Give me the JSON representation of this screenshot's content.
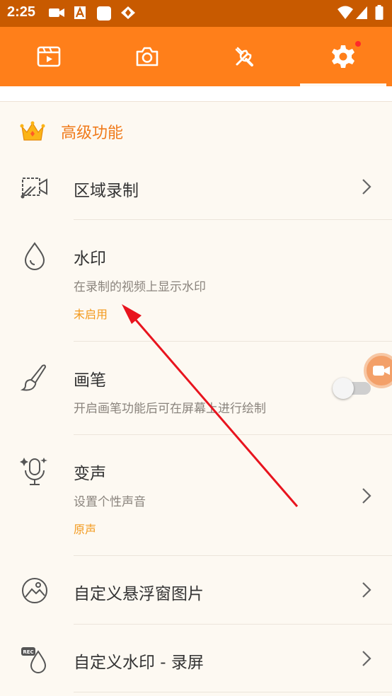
{
  "status_bar": {
    "time": "2:25"
  },
  "tabs": [
    {
      "name": "video-list"
    },
    {
      "name": "screenshot"
    },
    {
      "name": "tools"
    },
    {
      "name": "settings",
      "active": true,
      "has_notification": true
    }
  ],
  "section": {
    "title": "高级功能"
  },
  "items": [
    {
      "title": "区域录制"
    },
    {
      "title": "水印",
      "subtitle": "在录制的视频上显示水印",
      "state": "未启用"
    },
    {
      "title": "画笔",
      "subtitle": "开启画笔功能后可在屏幕上进行绘制",
      "toggle_on": false
    },
    {
      "title": "变声",
      "subtitle": "设置个性声音",
      "state": "原声"
    },
    {
      "title": "自定义悬浮窗图片"
    },
    {
      "title": "自定义水印 - 录屏"
    }
  ],
  "colors": {
    "status_bar": "#c85a00",
    "tab_bar": "#ff7f1a",
    "accent": "#f07a1a",
    "state_text": "#f39a1e",
    "annotation_arrow": "#e8141e"
  }
}
